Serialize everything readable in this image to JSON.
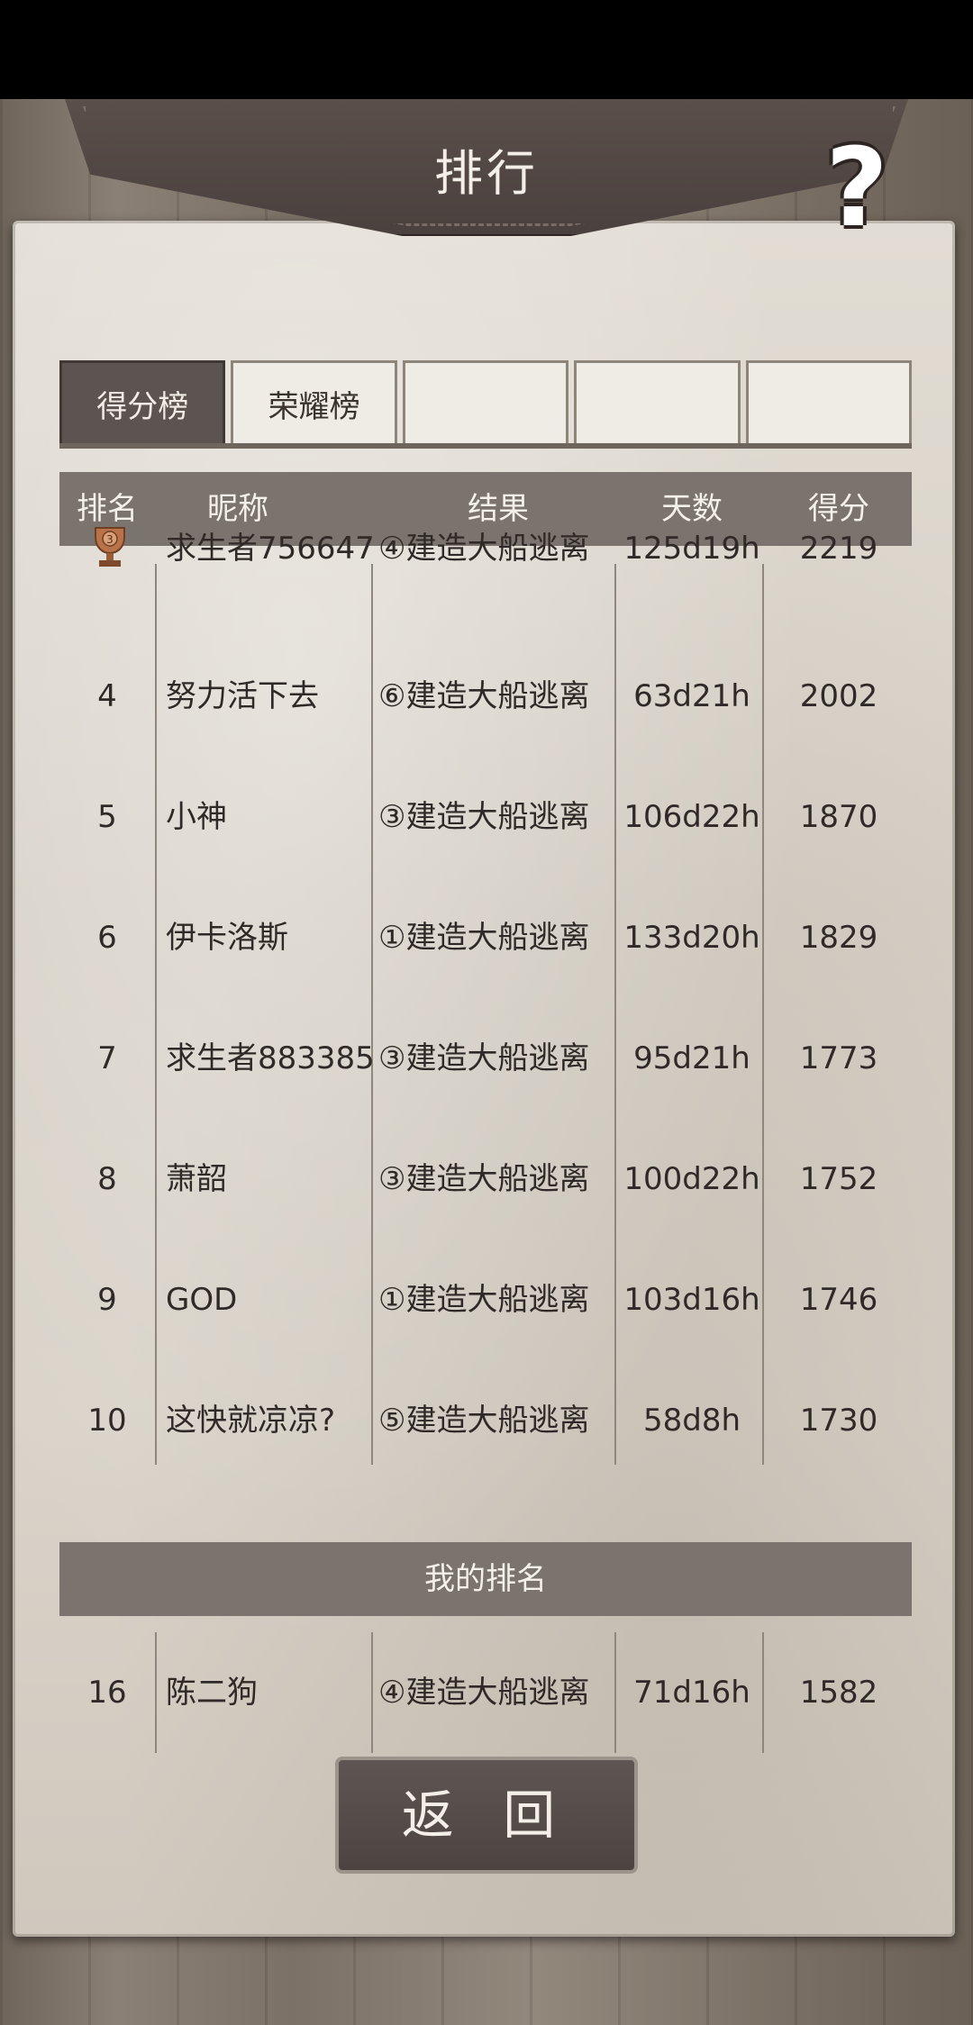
{
  "header": {
    "title": "排行",
    "help_symbol": "?"
  },
  "tabs": [
    {
      "label": "得分榜",
      "active": true
    },
    {
      "label": "荣耀榜",
      "active": false
    },
    {
      "label": "",
      "active": false
    },
    {
      "label": "",
      "active": false
    },
    {
      "label": "",
      "active": false
    }
  ],
  "table": {
    "columns": [
      "排名",
      "昵称",
      "结果",
      "天数",
      "得分"
    ],
    "rows": [
      {
        "rank": "",
        "medal": "bronze-trophy-3",
        "name": "求生者756647",
        "result": "④建造大船逃离",
        "days": "125d19h",
        "score": "2219"
      },
      {
        "rank": "4",
        "name": "努力活下去",
        "result": "⑥建造大船逃离",
        "days": "63d21h",
        "score": "2002"
      },
      {
        "rank": "5",
        "name": "小神",
        "result": "③建造大船逃离",
        "days": "106d22h",
        "score": "1870"
      },
      {
        "rank": "6",
        "name": "伊卡洛斯",
        "result": "①建造大船逃离",
        "days": "133d20h",
        "score": "1829"
      },
      {
        "rank": "7",
        "name": "求生者883385",
        "result": "③建造大船逃离",
        "days": "95d21h",
        "score": "1773"
      },
      {
        "rank": "8",
        "name": "萧韶",
        "result": "③建造大船逃离",
        "days": "100d22h",
        "score": "1752"
      },
      {
        "rank": "9",
        "name": "GOD",
        "result": "①建造大船逃离",
        "days": "103d16h",
        "score": "1746"
      },
      {
        "rank": "10",
        "name": "这快就凉凉?",
        "result": "⑤建造大船逃离",
        "days": "58d8h",
        "score": "1730"
      }
    ]
  },
  "my_rank": {
    "header": "我的排名",
    "row": {
      "rank": "16",
      "name": "陈二狗",
      "result": "④建造大船逃离",
      "days": "71d16h",
      "score": "1582"
    }
  },
  "footer": {
    "back_label": "返 回"
  }
}
